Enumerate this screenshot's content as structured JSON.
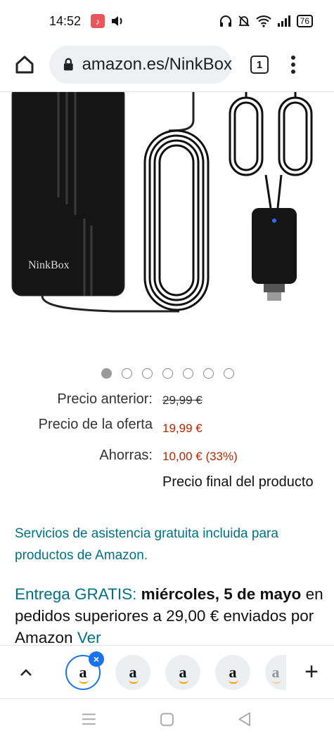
{
  "status_bar": {
    "time": "14:52",
    "battery": "76",
    "icons": [
      "music-app-icon",
      "volume-icon",
      "headphones-icon",
      "bell-off-icon",
      "wifi-icon",
      "signal-icon",
      "battery-icon"
    ]
  },
  "browser": {
    "url": "amazon.es/NinkBox",
    "tab_count": "1",
    "icons": [
      "home-icon",
      "lock-icon",
      "tabs-icon",
      "more-menu-icon"
    ]
  },
  "product": {
    "image_alt": "NinkBox",
    "carousel": {
      "total": 7,
      "active": 0
    },
    "price": {
      "previous_label": "Precio anterior:",
      "previous_value": "29,99 €",
      "offer_label": "Precio de la oferta",
      "offer_value": "19,99 €",
      "savings_label": "Ahorras:",
      "savings_value": "10,00 € (33%)",
      "final_note": "Precio final del producto"
    },
    "services_text": "Servicios de asistencia gratuita incluida para productos de Amazon.",
    "delivery": {
      "free_label": "Entrega GRATIS:",
      "date": "miércoles, 5 de mayo",
      "text": "en pedidos superiores a 29,00 € enviados por Amazon",
      "link": "Ver"
    }
  },
  "tab_strip": {
    "tabs": [
      {
        "label": "a",
        "active": true
      },
      {
        "label": "a",
        "active": false
      },
      {
        "label": "a",
        "active": false
      },
      {
        "label": "a",
        "active": false
      },
      {
        "label": "a",
        "active": false
      }
    ],
    "close_glyph": "×",
    "new_tab_glyph": "+"
  },
  "colors": {
    "accent_blue": "#1a73e8",
    "link_teal": "#007185",
    "price_red": "#b12704",
    "amazon_orange": "#ff9900"
  }
}
